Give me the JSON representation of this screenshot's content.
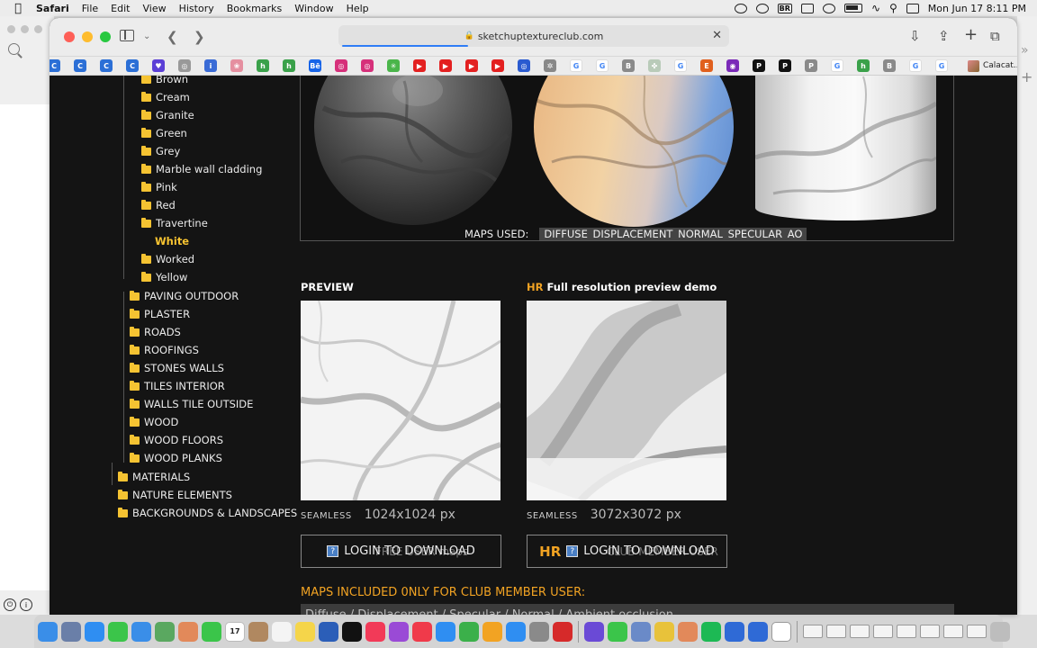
{
  "menubar": {
    "apple": "",
    "app": "Safari",
    "items": [
      "File",
      "Edit",
      "View",
      "History",
      "Bookmarks",
      "Window",
      "Help"
    ],
    "input_source": "BR",
    "clock": "Mon Jun 17  8:11 PM"
  },
  "browser": {
    "url": "sketchuptextureclub.com",
    "last_bookmark": "Calacat...",
    "favicons": [
      {
        "icon": "c-icon",
        "color": "#2b6fd6",
        "glyph": "C"
      },
      {
        "icon": "c-icon",
        "color": "#2b6fd6",
        "glyph": "C"
      },
      {
        "icon": "c-icon",
        "color": "#2b6fd6",
        "glyph": "C"
      },
      {
        "icon": "c-icon",
        "color": "#2b6fd6",
        "glyph": "C"
      },
      {
        "icon": "pocket-icon",
        "color": "#5b3fd6",
        "glyph": "♥"
      },
      {
        "icon": "camera-icon",
        "color": "#999999",
        "glyph": "◎"
      },
      {
        "icon": "info-icon",
        "color": "#3a6bd6",
        "glyph": "i"
      },
      {
        "icon": "brain-icon",
        "color": "#e58fa0",
        "glyph": "❀"
      },
      {
        "icon": "houzz-icon",
        "color": "#3aa14a",
        "glyph": "h"
      },
      {
        "icon": "houzz-icon",
        "color": "#3aa14a",
        "glyph": "h"
      },
      {
        "icon": "behance-icon",
        "color": "#1764e8",
        "glyph": "Bē"
      },
      {
        "icon": "instagram-icon",
        "color": "#d6307a",
        "glyph": "◎"
      },
      {
        "icon": "instagram-icon",
        "color": "#d6307a",
        "glyph": "◎"
      },
      {
        "icon": "spark-icon",
        "color": "#4ab54a",
        "glyph": "✳"
      },
      {
        "icon": "youtube-icon",
        "color": "#e32020",
        "glyph": "▶"
      },
      {
        "icon": "youtube-icon",
        "color": "#e32020",
        "glyph": "▶"
      },
      {
        "icon": "youtube-icon",
        "color": "#e32020",
        "glyph": "▶"
      },
      {
        "icon": "youtube-icon",
        "color": "#e32020",
        "glyph": "▶"
      },
      {
        "icon": "target-icon",
        "color": "#2a5bd0",
        "glyph": "◎"
      },
      {
        "icon": "chatgpt-icon",
        "color": "#888888",
        "glyph": "✲"
      },
      {
        "icon": "google-icon",
        "color": "#ffffff",
        "glyph": "G"
      },
      {
        "icon": "google-icon",
        "color": "#ffffff",
        "glyph": "G"
      },
      {
        "icon": "b-icon",
        "color": "#8a8a8a",
        "glyph": "B"
      },
      {
        "icon": "leaf-icon",
        "color": "#b9cbb9",
        "glyph": "✤"
      },
      {
        "icon": "google-icon",
        "color": "#ffffff",
        "glyph": "G"
      },
      {
        "icon": "e-icon",
        "color": "#e0601e",
        "glyph": "E"
      },
      {
        "icon": "circle-icon",
        "color": "#7a2ab8",
        "glyph": "◉"
      },
      {
        "icon": "pinterest-icon",
        "color": "#111111",
        "glyph": "P"
      },
      {
        "icon": "pinterest-icon",
        "color": "#111111",
        "glyph": "P"
      },
      {
        "icon": "p-icon",
        "color": "#8a8a8a",
        "glyph": "P"
      },
      {
        "icon": "google-icon",
        "color": "#ffffff",
        "glyph": "G"
      },
      {
        "icon": "houzz-icon",
        "color": "#3aa14a",
        "glyph": "h"
      },
      {
        "icon": "b-icon",
        "color": "#8a8a8a",
        "glyph": "B"
      },
      {
        "icon": "google-icon",
        "color": "#ffffff",
        "glyph": "G"
      },
      {
        "icon": "google-icon",
        "color": "#ffffff",
        "glyph": "G"
      }
    ]
  },
  "tree": {
    "sub_items": [
      "Brown",
      "Cream",
      "Granite",
      "Green",
      "Grey",
      "Marble wall cladding",
      "Pink",
      "Red",
      "Travertine"
    ],
    "active_item": "White",
    "sub_items_after": [
      "Worked",
      "Yellow"
    ],
    "categories": [
      "PAVING OUTDOOR",
      "PLASTER",
      "ROADS",
      "ROOFINGS",
      "STONES WALLS",
      "TILES INTERIOR",
      "WALLS TILE OUTSIDE",
      "WOOD",
      "WOOD FLOORS",
      "WOOD PLANKS"
    ],
    "top_categories": [
      "MATERIALS",
      "NATURE ELEMENTS",
      "BACKGROUNDS & LANDSCAPES"
    ]
  },
  "maps": {
    "label": "MAPS USED:",
    "list": "DIFFUSE DISPLACEMENT NORMAL SPECULAR  AO"
  },
  "preview": {
    "title": "PREVIEW",
    "seamless": "SEAMLESS",
    "size": "1024x1024 px",
    "login": "LOGIN TO DOWNLOAD",
    "ghost": "FREE USER    maps"
  },
  "hr": {
    "tag": "HR",
    "title": "Full resolution preview demo",
    "seamless": "SEAMLESS",
    "size": "3072x3072 px",
    "login": "LOGIN TO DOWNLOAD",
    "ghost": "CLUB MEMBER USER"
  },
  "club": {
    "heading": "MAPS INCLUDED 0NLY FOR CLUB MEMBER USER:",
    "list": "Diffuse / Displacement / Specular / Normal / Ambient occlusion"
  },
  "dock": {
    "items": [
      {
        "icon": "finder-icon",
        "color": "#3a8ee8"
      },
      {
        "icon": "launchpad-icon",
        "color": "#6a7fa8"
      },
      {
        "icon": "safari-icon",
        "color": "#2f8ef2"
      },
      {
        "icon": "messages-icon",
        "color": "#3bc54a"
      },
      {
        "icon": "mail-icon",
        "color": "#3a8ee8"
      },
      {
        "icon": "maps-icon",
        "color": "#5aa860"
      },
      {
        "icon": "photos-icon",
        "color": "#e2895a"
      },
      {
        "icon": "facetime-icon",
        "color": "#3bc54a"
      },
      {
        "icon": "calendar-icon",
        "color": "#ffffff"
      },
      {
        "icon": "contacts-icon",
        "color": "#b08860"
      },
      {
        "icon": "reminders-icon",
        "color": "#f4f4f4"
      },
      {
        "icon": "notes-icon",
        "color": "#f5d54a"
      },
      {
        "icon": "word-icon",
        "color": "#2b5eb8"
      },
      {
        "icon": "tv-icon",
        "color": "#111111"
      },
      {
        "icon": "music-icon",
        "color": "#f23a58"
      },
      {
        "icon": "podcasts-icon",
        "color": "#9a4ad6"
      },
      {
        "icon": "news-icon",
        "color": "#f03a4a"
      },
      {
        "icon": "keynote-icon",
        "color": "#2f8ef2"
      },
      {
        "icon": "numbers-icon",
        "color": "#3bb04a"
      },
      {
        "icon": "pages-icon",
        "color": "#f2a323"
      },
      {
        "icon": "appstore-icon",
        "color": "#2f8ef2"
      },
      {
        "icon": "settings-icon",
        "color": "#8a8a8a"
      },
      {
        "icon": "acrobat-icon",
        "color": "#d62a2a"
      },
      {
        "icon": "sep",
        "color": ""
      },
      {
        "icon": "notion-icon",
        "color": "#6a4ad6"
      },
      {
        "icon": "whatsapp-icon",
        "color": "#3bc54a"
      },
      {
        "icon": "preview-icon",
        "color": "#6a8ac8"
      },
      {
        "icon": "chrome-icon",
        "color": "#e8c23a"
      },
      {
        "icon": "messenger-icon",
        "color": "#e2895a"
      },
      {
        "icon": "spotify-icon",
        "color": "#1db954"
      },
      {
        "icon": "layers-icon",
        "color": "#2f6ad6"
      },
      {
        "icon": "layers-icon",
        "color": "#2f6ad6"
      },
      {
        "icon": "chatgpt-icon",
        "color": "#ffffff"
      },
      {
        "icon": "sep",
        "color": ""
      },
      {
        "icon": "window-thumb",
        "color": ""
      },
      {
        "icon": "window-thumb",
        "color": ""
      },
      {
        "icon": "window-thumb",
        "color": ""
      },
      {
        "icon": "window-thumb",
        "color": ""
      },
      {
        "icon": "window-thumb",
        "color": ""
      },
      {
        "icon": "window-thumb",
        "color": ""
      },
      {
        "icon": "window-thumb",
        "color": ""
      },
      {
        "icon": "window-thumb",
        "color": ""
      },
      {
        "icon": "trash-icon",
        "color": "#bdbdbd"
      }
    ],
    "calendar_day": "17"
  }
}
